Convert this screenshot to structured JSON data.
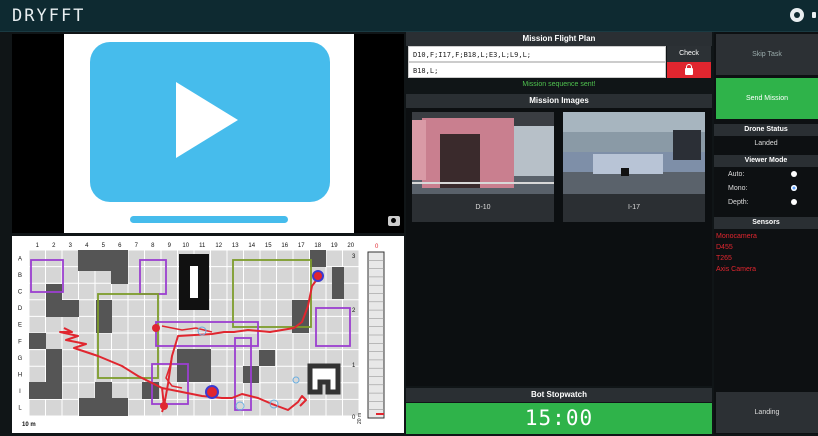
{
  "app": {
    "brand": "DRYFFT"
  },
  "mission": {
    "flight_plan_header": "Mission Flight Plan",
    "flight_plan_value": "D10,F;I17,F;B18,L;E3,L;L9,L;",
    "flight_plan_input2": "B18,L;",
    "check_label": "Check",
    "sent_message": "Mission sequence sent!",
    "images_header": "Mission Images",
    "images": [
      {
        "label": "D-10"
      },
      {
        "label": "I-17"
      }
    ],
    "stopwatch_header": "Bot Stopwatch",
    "stopwatch_value": "15:00"
  },
  "controls": {
    "skip_label": "Skip Task",
    "send_label": "Send Mission",
    "landing_label": "Landing"
  },
  "drone": {
    "status_header": "Drone Status",
    "status_value": "Landed",
    "viewer_header": "Viewer Mode",
    "viewer_options": [
      {
        "label": "Auto:",
        "selected": false
      },
      {
        "label": "Mono:",
        "selected": true
      },
      {
        "label": "Depth:",
        "selected": false
      }
    ],
    "sensors_header": "Sensors",
    "sensors": [
      "Monocamera",
      "D455",
      "T265",
      "Axis Camera"
    ]
  },
  "map": {
    "columns": [
      "1",
      "2",
      "3",
      "4",
      "5",
      "6",
      "7",
      "8",
      "9",
      "10",
      "11",
      "12",
      "13",
      "14",
      "15",
      "16",
      "17",
      "18",
      "19",
      "20"
    ],
    "rows": [
      "A",
      "B",
      "C",
      "D",
      "E",
      "F",
      "G",
      "H",
      "I",
      "L"
    ],
    "scale_label": "10 m",
    "height_scale": [
      "3",
      "2",
      "1",
      "0"
    ],
    "height_scale_top": "0",
    "height_unit": "20 m"
  },
  "colors": {
    "accent_green": "#2fb34a",
    "alert_red": "#e0262f",
    "panel_dark": "#2a2f33",
    "topbar": "#0e2a31"
  },
  "icons": {
    "settings": "settings-icon",
    "camera": "camera-icon",
    "lock": "lock-icon",
    "play": "play-icon"
  }
}
